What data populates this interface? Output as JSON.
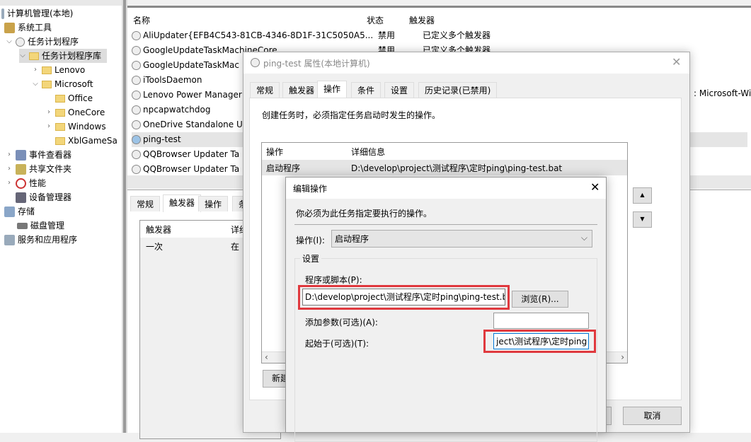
{
  "tree": {
    "items": [
      {
        "label": "计算机管理(本地)",
        "icon": "computer-management-icon"
      },
      {
        "label": "系统工具",
        "icon": "tools-icon"
      },
      {
        "label": "任务计划程序",
        "icon": "clock-icon"
      },
      {
        "label": "任务计划程序库",
        "icon": "folder-clock-icon"
      },
      {
        "label": "Lenovo",
        "icon": "folder-icon"
      },
      {
        "label": "Microsoft",
        "icon": "folder-icon"
      },
      {
        "label": "Office",
        "icon": "folder-icon"
      },
      {
        "label": "OneCore",
        "icon": "folder-icon"
      },
      {
        "label": "Windows",
        "icon": "folder-icon"
      },
      {
        "label": "XblGameSa",
        "icon": "folder-icon"
      },
      {
        "label": "事件查看器",
        "icon": "event-viewer-icon"
      },
      {
        "label": "共享文件夹",
        "icon": "shared-folder-icon"
      },
      {
        "label": "性能",
        "icon": "performance-icon"
      },
      {
        "label": "设备管理器",
        "icon": "device-manager-icon"
      },
      {
        "label": "存储",
        "icon": "storage-icon"
      },
      {
        "label": "磁盘管理",
        "icon": "disk-icon"
      },
      {
        "label": "服务和应用程序",
        "icon": "services-icon"
      }
    ]
  },
  "list": {
    "headers": [
      "名称",
      "状态",
      "触发器"
    ],
    "rows": [
      {
        "name": "AliUpdater{EFB4C543-81CB-4346-8D1F-31C5050A5...",
        "status": "禁用",
        "trigger": "已定义多个触发器"
      },
      {
        "name": "GoogleUpdateTaskMachineCore",
        "status": "禁用",
        "trigger": "已定义多个触发器"
      },
      {
        "name": "GoogleUpdateTaskMac",
        "status": "",
        "trigger": ""
      },
      {
        "name": "iToolsDaemon",
        "status": "",
        "trigger": ""
      },
      {
        "name": "Lenovo Power Manager",
        "status": "",
        "trigger": ""
      },
      {
        "name": "npcapwatchdog",
        "status": "",
        "trigger": ""
      },
      {
        "name": "OneDrive Standalone U",
        "status": "",
        "trigger": ""
      },
      {
        "name": "ping-test",
        "status": "",
        "trigger": ""
      },
      {
        "name": "QQBrowser Updater Ta",
        "status": "",
        "trigger": ""
      },
      {
        "name": "QQBrowser Updater Ta",
        "status": "",
        "trigger": ""
      }
    ],
    "side_text": ": Microsoft-Wi"
  },
  "lower": {
    "tabs": [
      "常规",
      "触发器",
      "操作",
      "条"
    ],
    "headers": [
      "触发器",
      "详细"
    ],
    "row": [
      "一次",
      "在"
    ]
  },
  "props": {
    "title": "ping-test 属性(本地计算机)",
    "tabs": [
      "常规",
      "触发器",
      "操作",
      "条件",
      "设置",
      "历史记录(已禁用)"
    ],
    "desc": "创建任务时，必须指定任务启动时发生的操作。",
    "headers": [
      "操作",
      "详细信息"
    ],
    "row": [
      "启动程序",
      "D:\\develop\\project\\测试程序\\定时ping\\ping-test.bat"
    ],
    "new_label": "新建",
    "cancel_label": "取消"
  },
  "edit": {
    "title": "编辑操作",
    "desc": "你必须为此任务指定要执行的操作。",
    "action_label": "操作(I):",
    "action_value": "启动程序",
    "group": "设置",
    "program_label": "程序或脚本(P):",
    "program_value": "D:\\develop\\project\\测试程序\\定时ping\\ping-test.bat",
    "browse_label": "浏览(R)...",
    "args_label": "添加参数(可选)(A):",
    "args_value": "",
    "start_label": "起始于(可选)(T):",
    "start_value": "ject\\测试程序\\定时ping",
    "highlight_color": "#e0393e"
  }
}
